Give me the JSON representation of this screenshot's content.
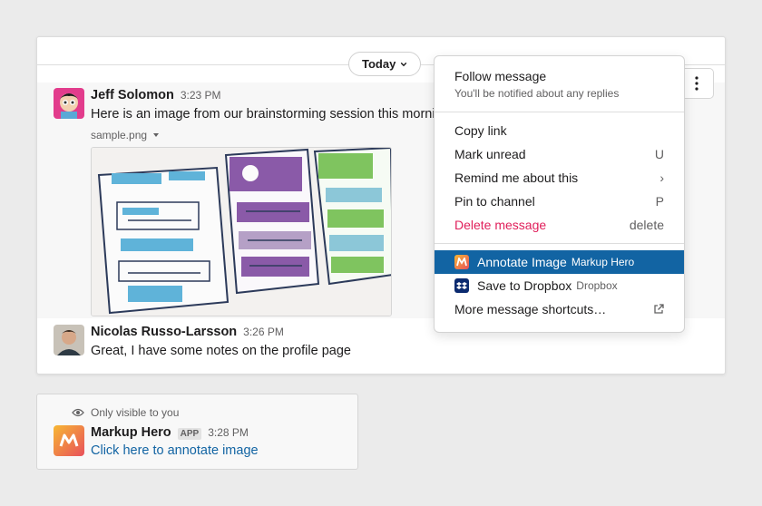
{
  "day_divider": {
    "label": "Today"
  },
  "messages": [
    {
      "author": "Jeff Solomon",
      "time": "3:23 PM",
      "text": "Here is an image from our brainstorming session this morning",
      "file_name": "sample.png"
    },
    {
      "author": "Nicolas Russo-Larsson",
      "time": "3:26 PM",
      "text": "Great, I have some notes on the profile page"
    }
  ],
  "context_menu": {
    "follow": {
      "title": "Follow message",
      "description": "You'll be notified about any replies"
    },
    "items": [
      {
        "label": "Copy link",
        "shortcut": ""
      },
      {
        "label": "Mark unread",
        "shortcut": "U"
      },
      {
        "label": "Remind me about this",
        "shortcut": "›"
      },
      {
        "label": "Pin to channel",
        "shortcut": "P"
      },
      {
        "label": "Delete message",
        "shortcut": "delete"
      }
    ],
    "apps": [
      {
        "label": "Annotate Image",
        "app": "Markup Hero",
        "icon": "markup-hero-icon"
      },
      {
        "label": "Save to Dropbox",
        "app": "Dropbox",
        "icon": "dropbox-icon"
      }
    ],
    "more": {
      "label": "More message shortcuts…",
      "icon": "external-link-icon"
    }
  },
  "ephemeral": {
    "note": "Only visible to you",
    "author": "Markup Hero",
    "badge": "APP",
    "time": "3:28 PM",
    "link_text": "Click here to annotate image"
  },
  "colors": {
    "selected": "#1264a3",
    "danger": "#e01e5a",
    "link": "#1264a3"
  }
}
